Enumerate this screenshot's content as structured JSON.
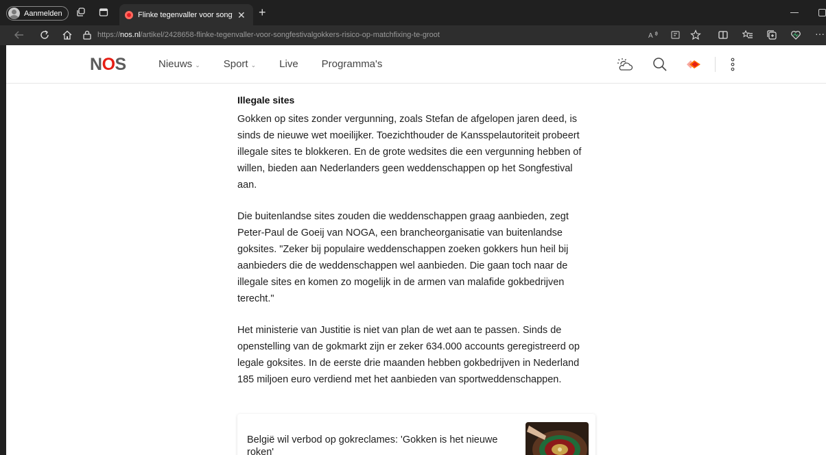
{
  "browser": {
    "profile_label": "Aanmelden",
    "tab_title": "Flinke tegenvaller voor songfesti",
    "url_prefix": "https://",
    "url_host": "nos.nl",
    "url_path": "/artikel/2428658-flinke-tegenvaller-voor-songfestivalgokkers-risico-op-matchfixing-te-groot",
    "icons": [
      "profile-icon",
      "workspaces-icon",
      "tab-actions-icon",
      "close-tab-icon",
      "new-tab-icon",
      "back-icon",
      "refresh-icon",
      "home-icon",
      "site-info-icon",
      "read-aloud-icon",
      "immersive-reader-icon",
      "favorite-star-icon",
      "split-screen-icon",
      "favorites-icon",
      "collections-icon",
      "browser-essentials-icon",
      "more-icon"
    ]
  },
  "site": {
    "logo_left": "N",
    "logo_mid": "O",
    "logo_right": "S",
    "nav": [
      {
        "label": "Nieuws",
        "has_dropdown": true
      },
      {
        "label": "Sport",
        "has_dropdown": true
      },
      {
        "label": "Live",
        "has_dropdown": false
      },
      {
        "label": "Programma's",
        "has_dropdown": false
      }
    ],
    "header_icons": [
      "weather-icon",
      "search-icon",
      "npo-start-icon",
      "more-vertical-icon"
    ],
    "brand_color": "#e61e14"
  },
  "article": {
    "heading": "Illegale sites",
    "paragraphs": [
      "Gokken op sites zonder vergunning, zoals Stefan de afgelopen jaren deed, is sinds de nieuwe wet moeilijker. Toezichthouder de Kansspelautoriteit probeert illegale sites te blokkeren. En de grote wedsites die een vergunning hebben of willen, bieden aan Nederlanders geen weddenschappen op het Songfestival aan.",
      "Die buitenlandse sites zouden die weddenschappen graag aanbieden, zegt Peter-Paul de Goeij van NOGA, een brancheorganisatie van buitenlandse goksites. \"Zeker bij populaire weddenschappen zoeken gokkers hun heil bij aanbieders die de weddenschappen wel aanbieden. Die gaan toch naar de illegale sites en komen zo mogelijk in de armen van malafide gokbedrijven terecht.\"",
      "Het ministerie van Justitie is niet van plan de wet aan te passen. Sinds de openstelling van de gokmarkt zijn er zeker 634.000 accounts geregistreerd op legale goksites. In de eerste drie maanden hebben gokbedrijven in Nederland 185 miljoen euro verdiend met het aanbieden van sportweddenschappen."
    ],
    "related": {
      "title": "België wil verbod op gokreclames: 'Gokken is het nieuwe roken'"
    }
  }
}
